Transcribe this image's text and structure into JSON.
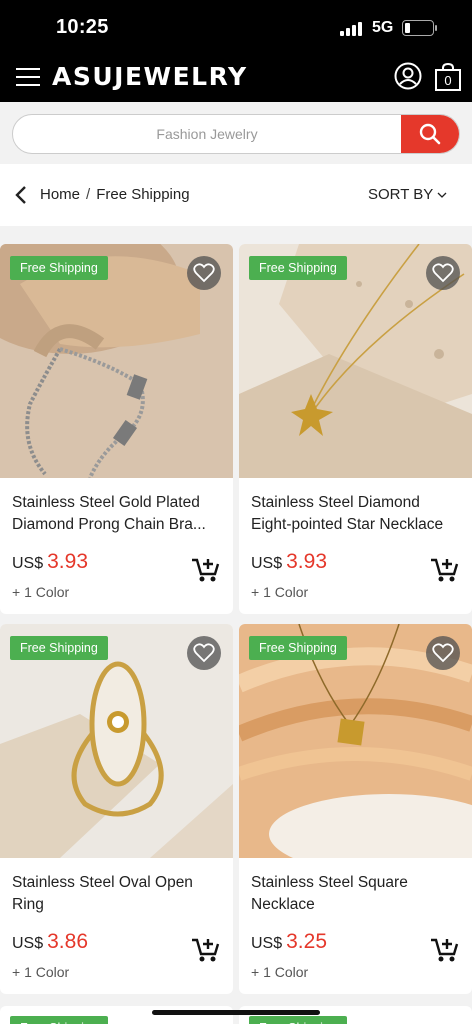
{
  "status_bar": {
    "time": "10:25",
    "network": "5G"
  },
  "header": {
    "logo": "ASUJEWELRY",
    "cart_count": "0"
  },
  "search": {
    "placeholder": "Fashion Jewelry"
  },
  "breadcrumb": {
    "home": "Home",
    "separator": "/",
    "current": "Free Shipping",
    "sort_label": "SORT BY"
  },
  "products": [
    {
      "badge": "Free Shipping",
      "title": "Stainless Steel Gold Plated Diamond Prong Chain Bra...",
      "currency": "US$",
      "price": "3.93",
      "colors": "+ 1 Color"
    },
    {
      "badge": "Free Shipping",
      "title": "Stainless Steel Diamond Eight-pointed Star Necklace",
      "currency": "US$",
      "price": "3.93",
      "colors": "+ 1 Color"
    },
    {
      "badge": "Free Shipping",
      "title": "Stainless Steel Oval Open Ring",
      "currency": "US$",
      "price": "3.86",
      "colors": "+ 1 Color"
    },
    {
      "badge": "Free Shipping",
      "title": "Stainless Steel Square Necklace",
      "currency": "US$",
      "price": "3.25",
      "colors": "+ 1 Color"
    },
    {
      "badge": "Free Shipping"
    },
    {
      "badge": "Free Shipping"
    }
  ],
  "colors": {
    "accent": "#e5382b",
    "badge": "#4caf50",
    "header_bg": "#000000"
  },
  "icons": [
    "menu-icon",
    "user-icon",
    "shopping-bag-icon",
    "search-icon",
    "back-chevron-icon",
    "chevron-down-icon",
    "heart-icon",
    "add-to-cart-icon"
  ]
}
